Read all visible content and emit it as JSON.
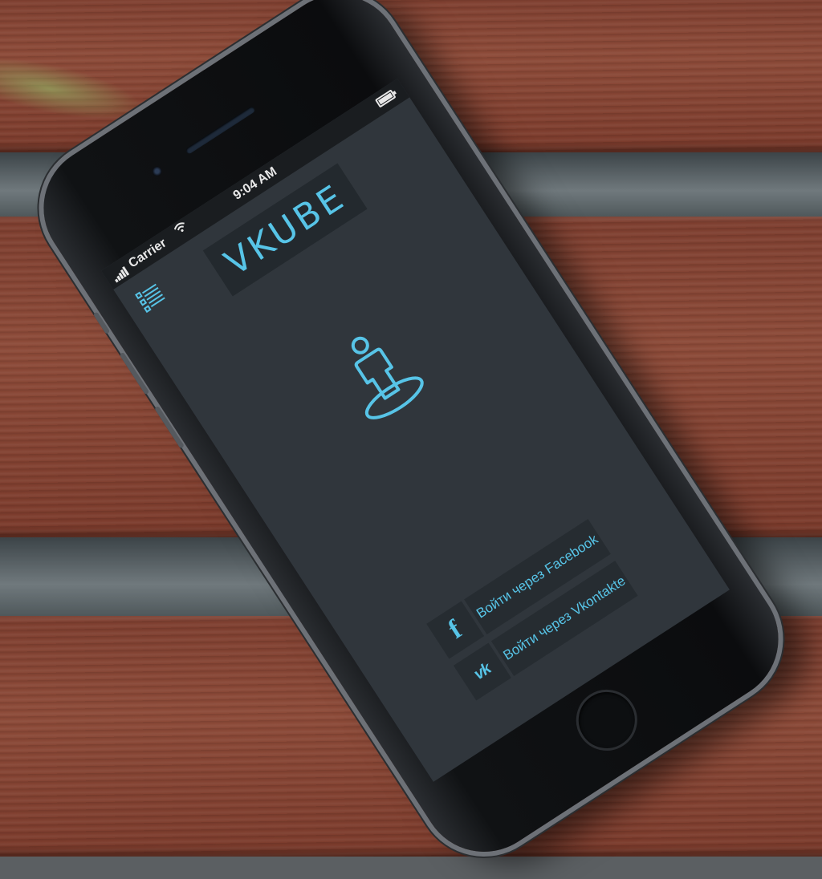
{
  "status_bar": {
    "carrier": "Carrier",
    "wifi_icon": "wifi-icon",
    "time": "9:04 AM",
    "battery_icon": "battery-icon"
  },
  "menu": {
    "icon": "list-menu-icon"
  },
  "logo": {
    "text": "VKUBE"
  },
  "avatar": {
    "icon": "person-on-platform-icon"
  },
  "login": {
    "facebook": {
      "icon_glyph": "f",
      "label": "Войти через Facebook"
    },
    "vkontakte": {
      "icon_glyph": "vk",
      "label": "Войти через Vkontakte"
    }
  },
  "colors": {
    "accent": "#57c4e7",
    "screen_bg": "#30363c",
    "button_bg": "#262c31"
  }
}
